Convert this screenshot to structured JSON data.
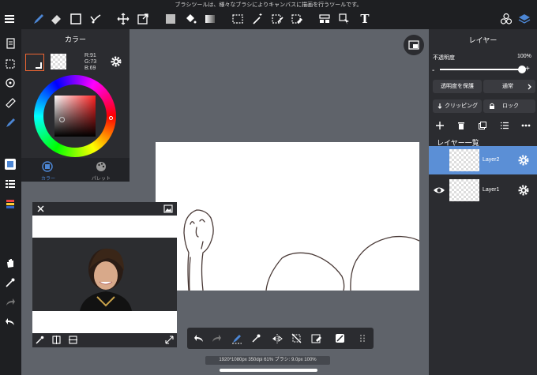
{
  "top_bar": {
    "tip_text": "ブラシツールは、様々なブラシによりキャンバスに描画を行うツールです。",
    "text_tool_glyph": "T"
  },
  "color_panel": {
    "title": "カラー",
    "rgb": {
      "r": "R:91",
      "g": "G:73",
      "b": "B:69"
    },
    "current_color": "#5b4945",
    "tabs": [
      {
        "label": "カラー",
        "active": true
      },
      {
        "label": "パレット",
        "active": false
      }
    ]
  },
  "layer_panel": {
    "title": "レイヤー",
    "opacity_label": "不透明度",
    "opacity_value": "100%",
    "opacity_level": 1.0,
    "protect_alpha_label": "透明度を保護",
    "blend_mode_label": "通常",
    "clipping_label": "クリッピング",
    "lock_label": "ロック",
    "list_title": "レイヤー一覧",
    "layers": [
      {
        "name": "Layer2",
        "selected": true
      },
      {
        "name": "Layer1",
        "selected": false
      }
    ]
  },
  "status": {
    "text": "1920*1080px 350dpi 61% ブラシ: 9.0px 100%"
  },
  "colors": {
    "accent": "#4c86d4",
    "panel_bg": "#2b2c30",
    "bar_bg": "#1e1f22",
    "workspace_bg": "#5f636a",
    "selected_layer_bg": "#5b8fd6"
  }
}
